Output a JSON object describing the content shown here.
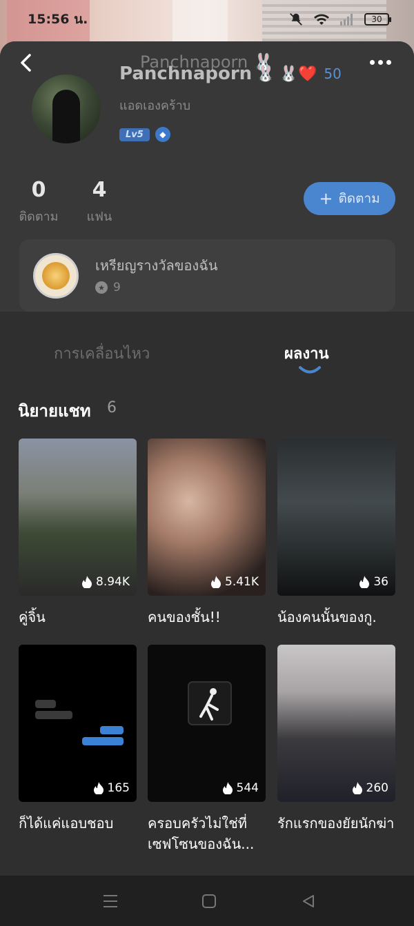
{
  "status_bar": {
    "time": "15:56 น.",
    "battery": "30"
  },
  "header": {
    "ghost_title": "Panchnaporn 🐰",
    "name": "Panchnaporn",
    "name_emoji": "🐰",
    "heart_emoji": "🐰❤️",
    "heart_count": "50",
    "bio": "แอดเองคร้าบ",
    "level": "Lv5"
  },
  "stats": {
    "following_count": "0",
    "following_label": "ติดตาม",
    "fans_count": "4",
    "fans_label": "แฟน",
    "follow_button": "ติดตาม"
  },
  "medals": {
    "title": "เหรียญรางวัลของฉัน",
    "count": "9"
  },
  "tabs": [
    {
      "label": "การเคลื่อนไหว",
      "active": false
    },
    {
      "label": "ผลงาน",
      "active": true
    }
  ],
  "section": {
    "title": "นิยายแชท",
    "count": "6"
  },
  "stories": [
    {
      "title": "คู่จิ้น",
      "views": "8.94K"
    },
    {
      "title": "คนของชั้น!!",
      "views": "5.41K"
    },
    {
      "title": "น้องคนนั้นของกู.",
      "views": "36"
    },
    {
      "title": "ก็ได้แค่แอบชอบ",
      "views": "165"
    },
    {
      "title": "ครอบครัวไม่ใช่ที่เซฟโซนของฉัน...",
      "views": "544"
    },
    {
      "title": "รักแรกของยัยนักฆ่า",
      "views": "260"
    }
  ],
  "colors": {
    "accent": "#4a86cf",
    "background": "#2f2f2f"
  }
}
